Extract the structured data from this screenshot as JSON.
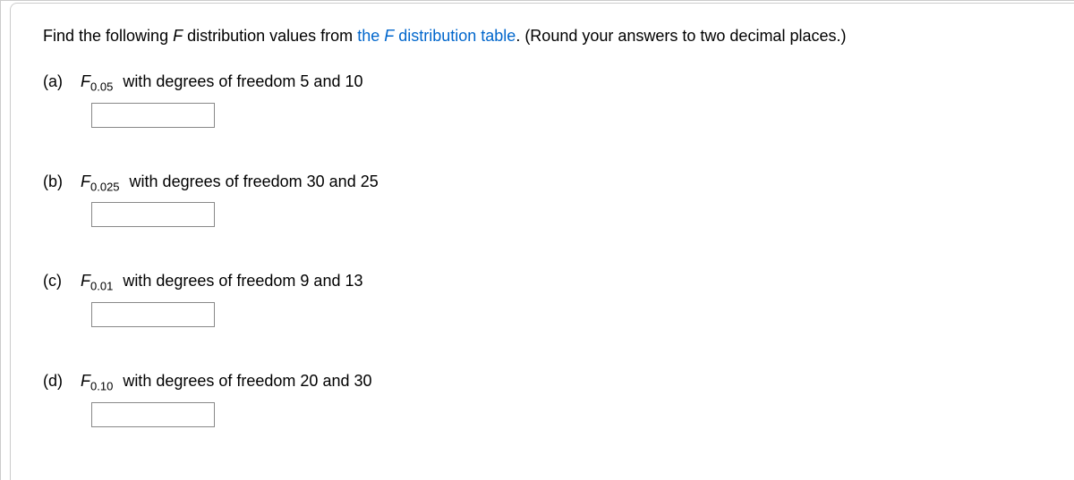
{
  "instruction": {
    "prefix": "Find the following ",
    "f_italic": "F",
    "mid": " distribution values from ",
    "link_text_the": "the ",
    "link_text_f": "F",
    "link_text_rest": " distribution table",
    "suffix": ". (Round your answers to two decimal places.)"
  },
  "questions": [
    {
      "label": "(a)",
      "f": "F",
      "sub": "0.05",
      "rest": " with degrees of freedom 5 and 10"
    },
    {
      "label": "(b)",
      "f": "F",
      "sub": "0.025",
      "rest": " with degrees of freedom 30 and 25"
    },
    {
      "label": "(c)",
      "f": "F",
      "sub": "0.01",
      "rest": " with degrees of freedom 9 and 13"
    },
    {
      "label": "(d)",
      "f": "F",
      "sub": "0.10",
      "rest": " with degrees of freedom 20 and 30"
    }
  ]
}
